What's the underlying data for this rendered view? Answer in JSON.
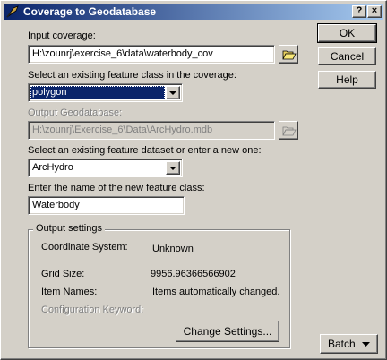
{
  "window": {
    "title": "Coverage to Geodatabase",
    "help_label": "?",
    "close_label": "×"
  },
  "input_coverage": {
    "label": "Input coverage:",
    "value": "H:\\zounrj\\exercise_6\\data\\waterbody_cov"
  },
  "feature_class": {
    "label": "Select an existing feature class in the coverage:",
    "value": "polygon"
  },
  "output_gdb": {
    "label": "Output Geodatabase:",
    "value": "H:\\zounrj\\Exercise_6\\Data\\ArcHydro.mdb"
  },
  "feature_dataset": {
    "label": "Select an existing feature dataset or enter a new one:",
    "value": "ArcHydro"
  },
  "new_class": {
    "label": "Enter the name of the new feature class:",
    "value": "Waterbody"
  },
  "output_settings": {
    "title": "Output settings",
    "coord_label": "Coordinate System:",
    "coord_value": "Unknown",
    "grid_label": "Grid Size:",
    "grid_value": "9956.96366566902",
    "item_label": "Item Names:",
    "item_value": "Items automatically changed.",
    "config_label": "Configuration Keyword:",
    "change_button": "Change Settings..."
  },
  "buttons": {
    "ok": "OK",
    "cancel": "Cancel",
    "help": "Help",
    "batch": "Batch"
  },
  "icons": {
    "title": "arctoolbox-icon",
    "browse": "open-folder-icon",
    "batch_arrow": "triangle-down"
  }
}
